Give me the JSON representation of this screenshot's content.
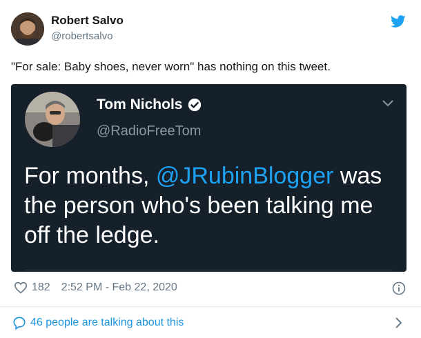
{
  "tweet": {
    "author_name": "Robert Salvo",
    "author_handle": "@robertsalvo",
    "text": "\"For sale: Baby shoes, never worn\" has nothing on this tweet.",
    "likes": "182",
    "timestamp": "2:52 PM - Feb 22, 2020",
    "talking": "46 people are talking about this"
  },
  "embedded": {
    "author_name": "Tom Nichols",
    "author_handle": "@RadioFreeTom",
    "text_before": "For months, ",
    "mention": "@JRubinBlogger",
    "text_after": " was the person who's been talking me off the ledge."
  },
  "icons": {
    "brand": "twitter-bird-icon",
    "verified": "verified-badge-icon",
    "like": "heart-icon",
    "info": "info-icon",
    "reply": "speech-bubble-icon",
    "more": "chevron-down-icon",
    "go": "chevron-right-icon"
  },
  "colors": {
    "brand_blue": "#1da1f2",
    "link_blue": "#1b95e0",
    "embed_bg": "#15202b"
  }
}
